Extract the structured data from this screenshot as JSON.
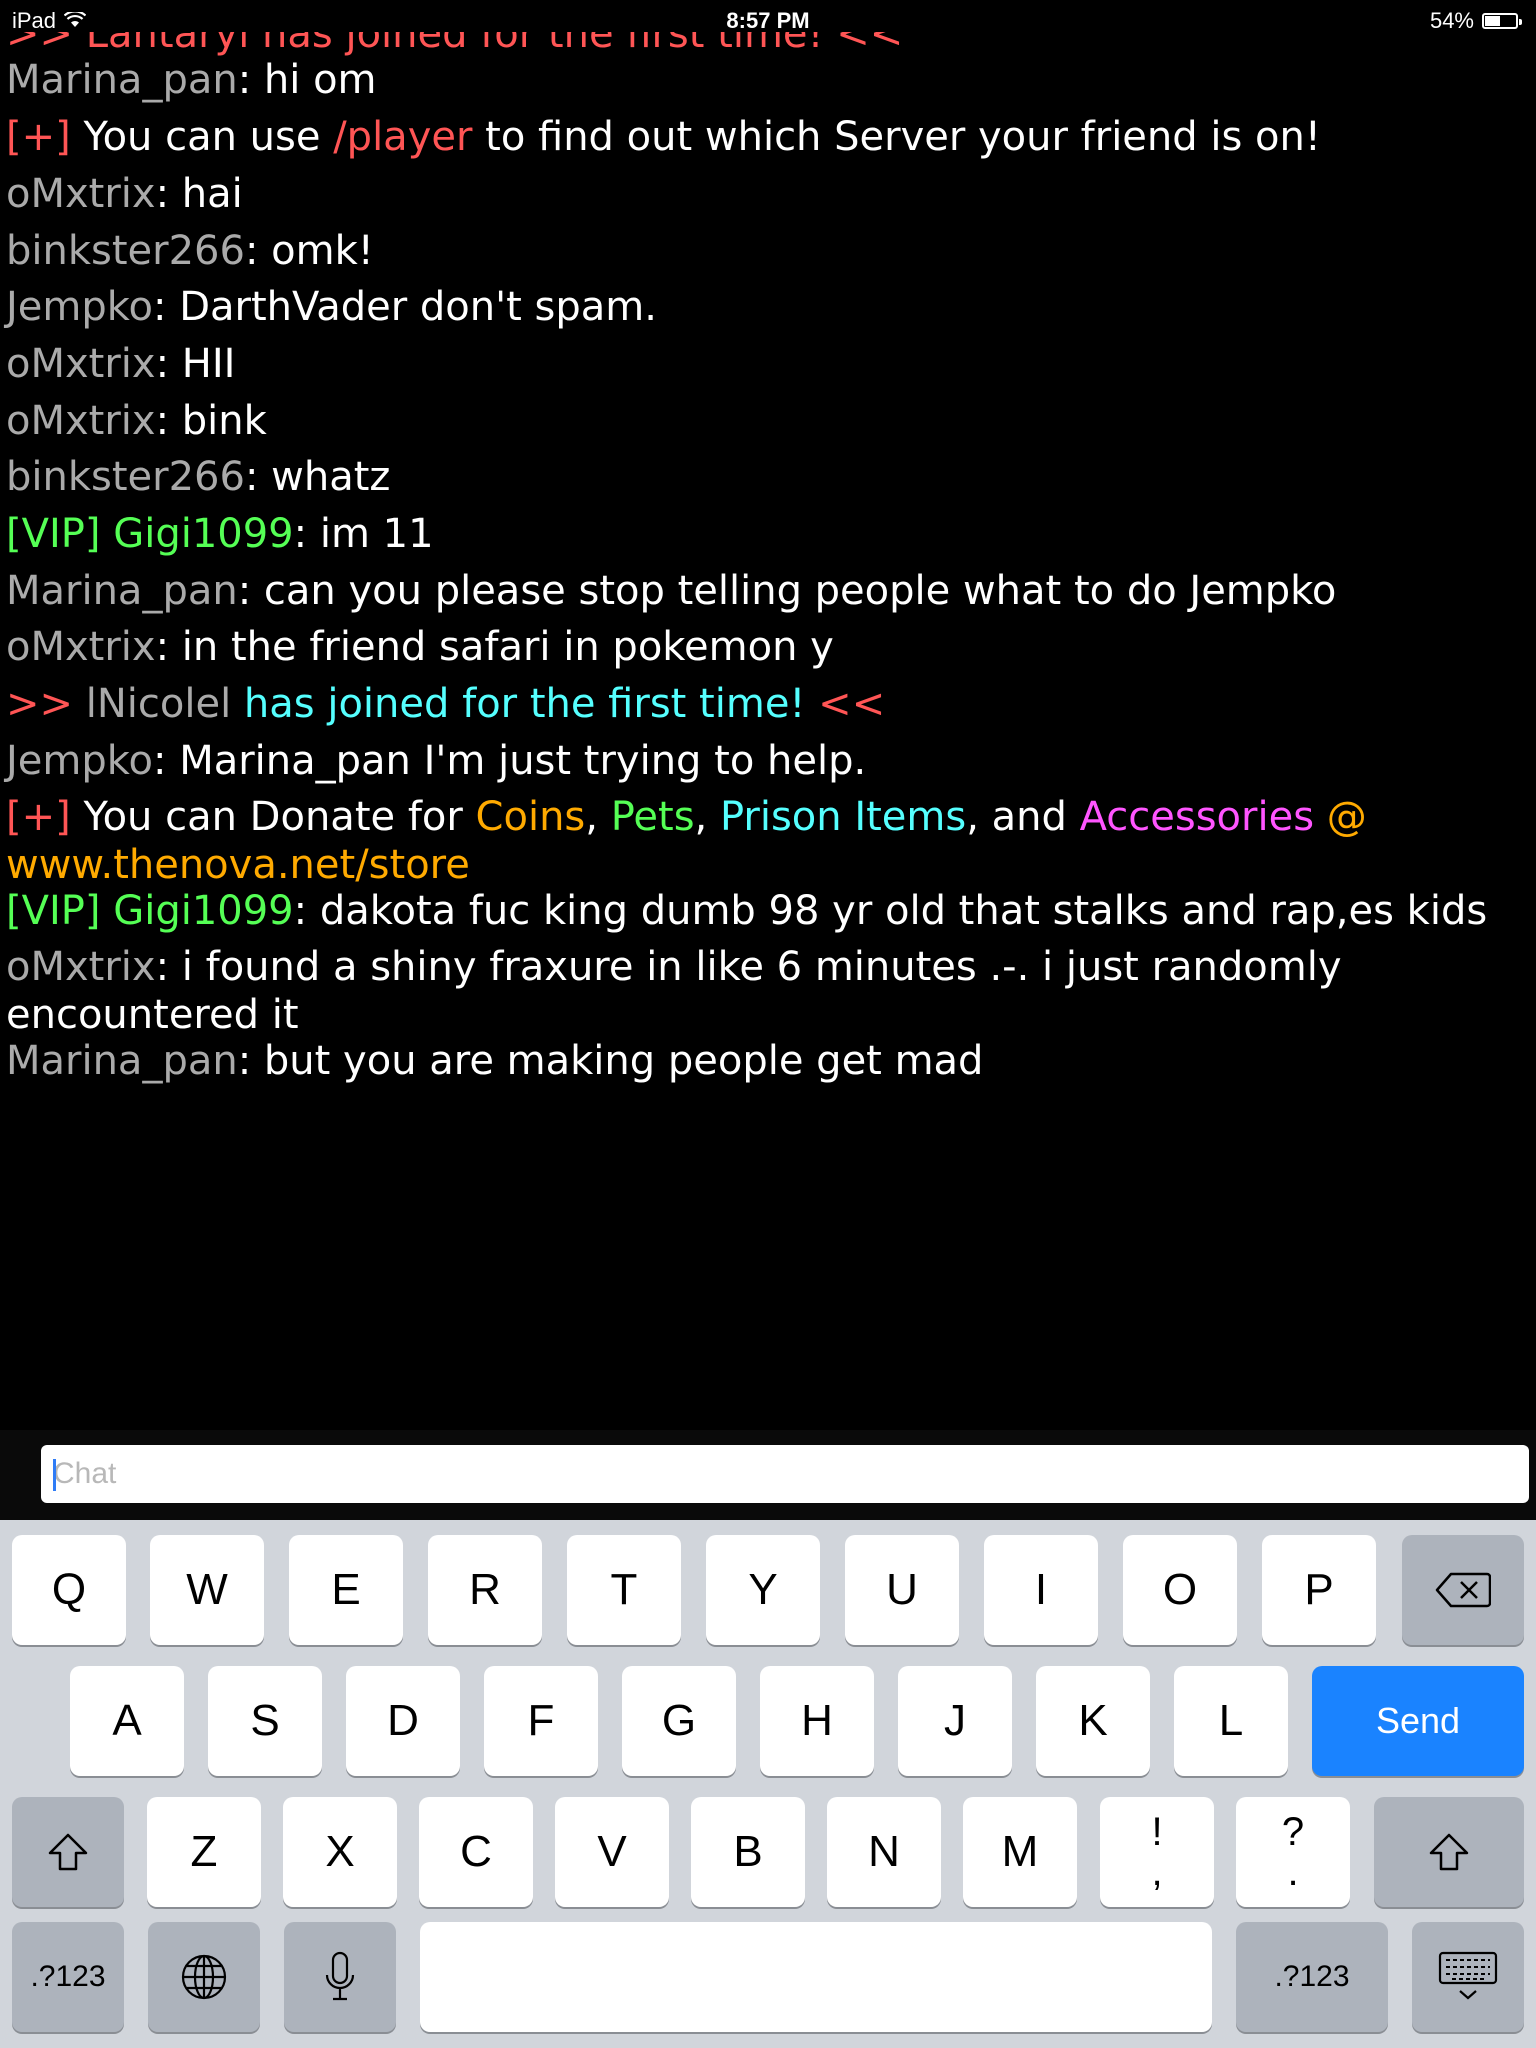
{
  "status_bar": {
    "device": "iPad",
    "time": "8:57 PM",
    "battery": "54%",
    "battery_level": 0.54
  },
  "chat": {
    "partial_top": ">> Lantaryi has joined for the first time! <<",
    "messages": [
      {
        "user": "Marina_pan",
        "sep": ": ",
        "text": "hi om"
      },
      {
        "prefix": "[+]",
        "text1": " You can use ",
        "cmd": "/player",
        "text2": " to find out which Server your friend is on!"
      },
      {
        "user": "oMxtrix",
        "sep": ": ",
        "text": "hai"
      },
      {
        "user": "binkster266",
        "sep": ": ",
        "text": "omk!"
      },
      {
        "user": "Jempko",
        "sep": ": ",
        "text": "DarthVader don't spam."
      },
      {
        "user": "oMxtrix",
        "sep": ": ",
        "text": "HII"
      },
      {
        "user": "oMxtrix",
        "sep": ": ",
        "text": "bink"
      },
      {
        "user": "binkster266",
        "sep": ": ",
        "text": "whatz"
      },
      {
        "user": "[VIP] Gigi1099",
        "sep": ": ",
        "text": "im 11"
      },
      {
        "user": "Marina_pan",
        "sep": ": ",
        "text": "can you please stop telling people what to do Jempko"
      },
      {
        "user": "oMxtrix",
        "sep": ": ",
        "text": "in the friend safari in pokemon y"
      },
      {
        "open": ">>",
        "user": " lNicolel ",
        "text": "has joined for the first time!",
        "close": " <<"
      },
      {
        "user": "Jempko",
        "sep": ": ",
        "text": "Marina_pan I'm just trying to help."
      },
      {
        "prefix": "[+]",
        "text1": " You can Donate for ",
        "coins": "Coins",
        "comma1": ", ",
        "pets": "Pets",
        "comma2": ", ",
        "prison": "Prison Items",
        "and": ", and ",
        "accessories": "Accessories",
        "at": " @",
        "url": "www.thenova.net/store"
      },
      {
        "user": "[VIP] Gigi1099",
        "sep": ": ",
        "text": "dakota fuc king dumb 98 yr old that stalks and rap,es kids"
      },
      {
        "user": "oMxtrix",
        "sep": ": ",
        "text": "i found a shiny fraxure in like 6 minutes .-. i just randomly encountered it"
      },
      {
        "user": "Marina_pan",
        "sep": ": ",
        "text": "but you are making people get mad"
      }
    ],
    "input_placeholder": "Chat"
  },
  "keyboard": {
    "row1": [
      "Q",
      "W",
      "E",
      "R",
      "T",
      "Y",
      "U",
      "I",
      "O",
      "P"
    ],
    "row2": [
      "A",
      "S",
      "D",
      "F",
      "G",
      "H",
      "J",
      "K",
      "L"
    ],
    "row3": [
      "Z",
      "X",
      "C",
      "V",
      "B",
      "N",
      "M"
    ],
    "punct1": {
      "top": "!",
      "bottom": ","
    },
    "punct2": {
      "top": "?",
      "bottom": "."
    },
    "send": "Send",
    "numbers_left": ".?123",
    "numbers_right": ".?123"
  },
  "icons": [
    "wifi-icon",
    "battery-icon",
    "backspace-icon",
    "shift-icon",
    "globe-icon",
    "microphone-icon",
    "keyboard-dismiss-icon"
  ]
}
